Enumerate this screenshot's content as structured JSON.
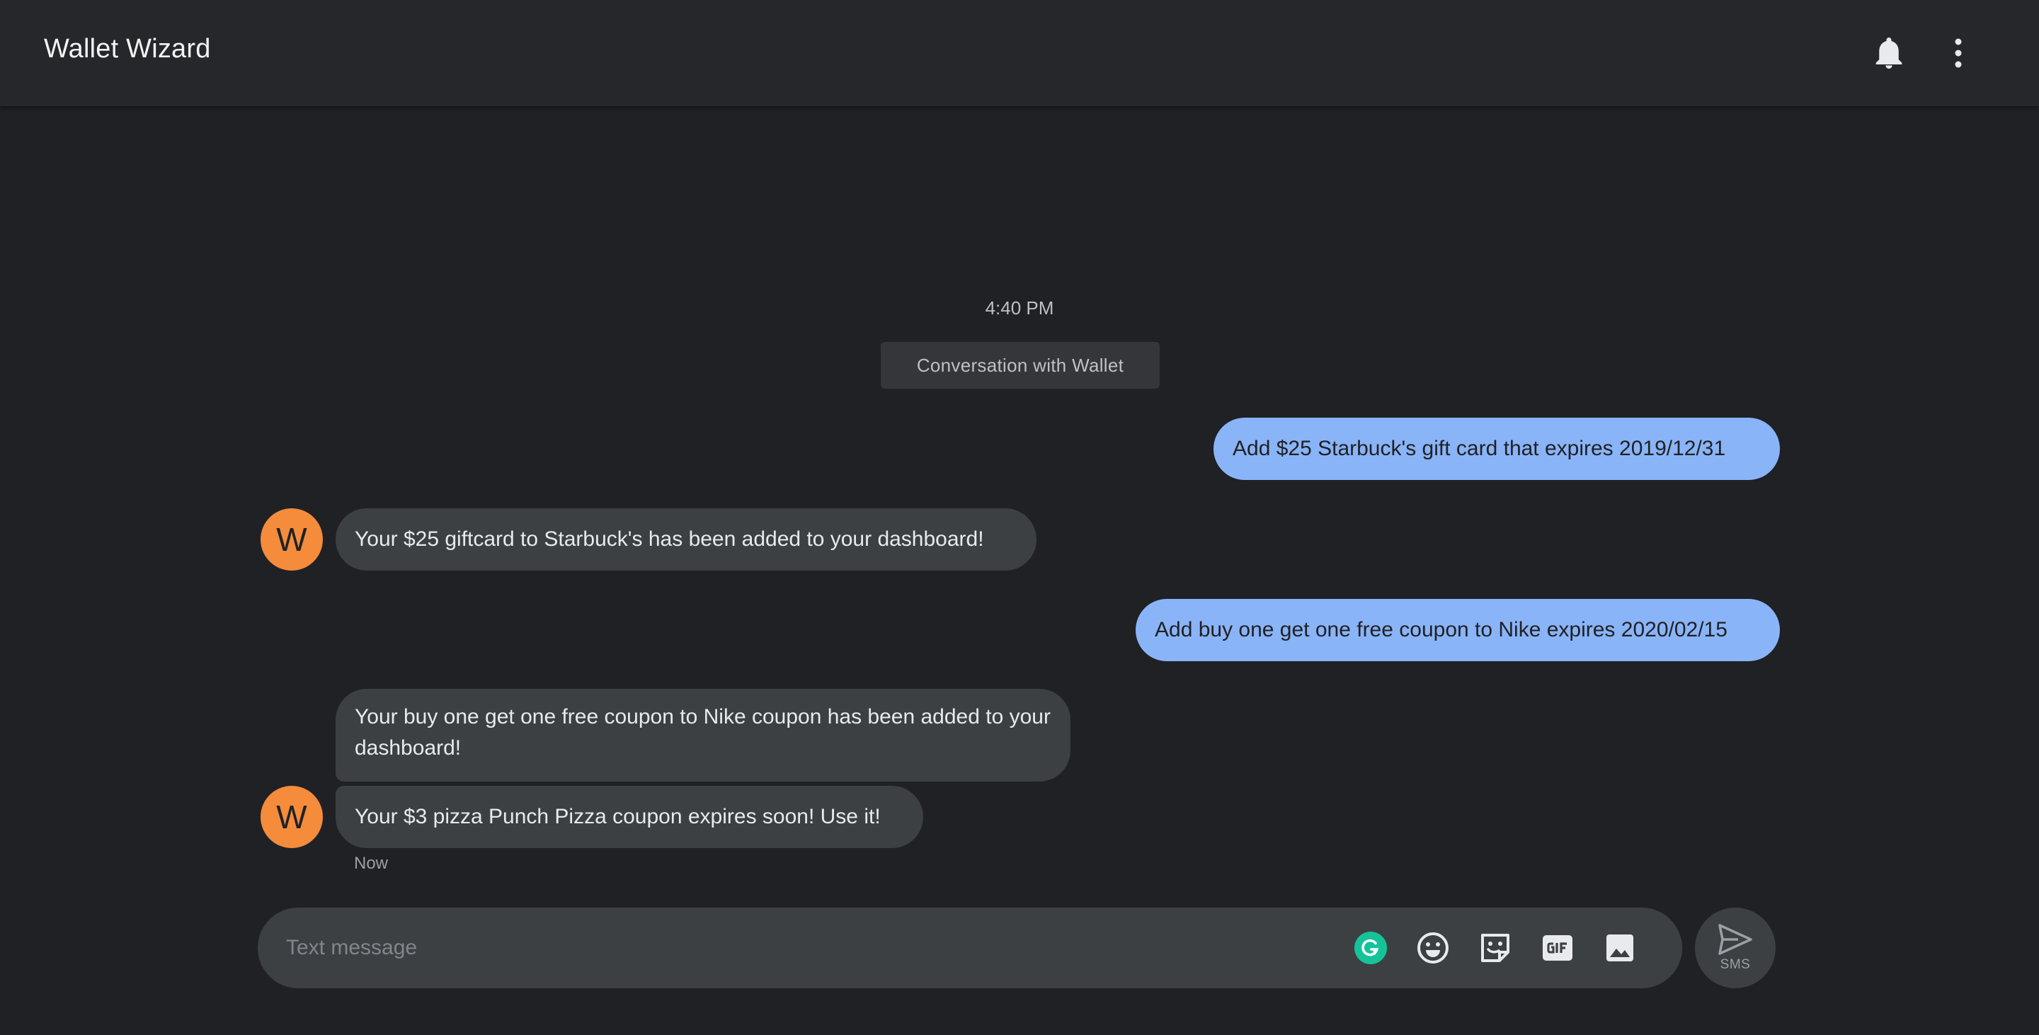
{
  "header": {
    "title": "Wallet Wizard",
    "icons": [
      "bell-icon",
      "more-vert-icon"
    ]
  },
  "conversation": {
    "timestamp": "4:40 PM",
    "info_chip": "Conversation with Wallet",
    "messages": [
      {
        "direction": "outgoing",
        "text": "Add $25 Starbuck's gift card that expires 2019/12/31"
      },
      {
        "direction": "incoming",
        "avatar": "W",
        "text": "Your $25 giftcard to Starbuck's has been added to your dashboard!"
      },
      {
        "direction": "outgoing",
        "text": "Add buy one get one free coupon to Nike expires 2020/02/15"
      },
      {
        "direction": "incoming",
        "text": "Your buy one get one free coupon to Nike coupon has been added to your dashboard!"
      },
      {
        "direction": "incoming",
        "avatar": "W",
        "text": "Your $3 pizza Punch Pizza coupon expires soon! Use it!"
      }
    ],
    "last_status": "Now"
  },
  "compose": {
    "placeholder": "Text message",
    "value": "",
    "icons": [
      "grammarly-icon",
      "emoji-icon",
      "sticker-icon",
      "gif-icon",
      "image-icon"
    ],
    "send_label": "SMS"
  },
  "colors": {
    "background": "#202124",
    "header": "#26272b",
    "outgoing_bubble": "#8ab4f8",
    "incoming_bubble": "#3c4043",
    "avatar": "#f48c3c",
    "grammarly": "#15c39a"
  }
}
